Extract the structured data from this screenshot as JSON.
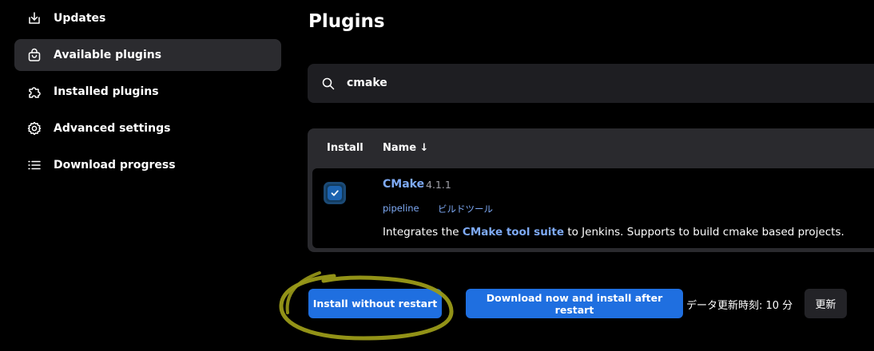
{
  "sidebar": {
    "items": [
      {
        "label": "Updates",
        "icon": "download-icon",
        "active": false
      },
      {
        "label": "Available plugins",
        "icon": "shopping-bag-icon",
        "active": true
      },
      {
        "label": "Installed plugins",
        "icon": "puzzle-icon",
        "active": false
      },
      {
        "label": "Advanced settings",
        "icon": "gear-icon",
        "active": false
      },
      {
        "label": "Download progress",
        "icon": "list-icon",
        "active": false
      }
    ]
  },
  "main": {
    "title": "Plugins",
    "search": {
      "value": "cmake",
      "icon": "search-icon"
    },
    "table": {
      "headers": {
        "install": "Install",
        "name": "Name ↓"
      },
      "rows": [
        {
          "checked": true,
          "name": "CMake",
          "version": "4.1.1",
          "tags": [
            "pipeline",
            "ビルドツール"
          ],
          "description_prefix": "Integrates the ",
          "description_link": "CMake tool suite",
          "description_suffix": " to Jenkins. Supports to build cmake based projects."
        }
      ]
    }
  },
  "actions": {
    "install_without_restart": "Install without restart",
    "download_and_install_after_restart": "Download now and install after restart",
    "updated_info": "データ更新時刻: 10 分",
    "refresh": "更新"
  },
  "colors": {
    "background": "#000000",
    "sidebar_active": "#2b2b2f",
    "link": "#7eaaf5",
    "primary_button": "#1f6fe0",
    "annotation": "#a8a81a"
  }
}
